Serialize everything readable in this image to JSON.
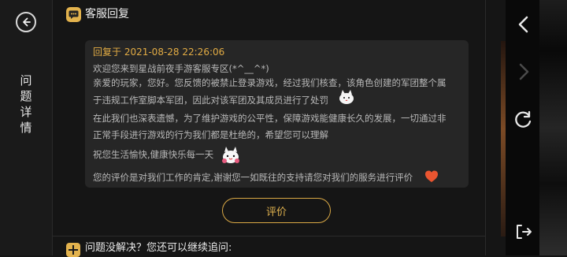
{
  "sidebar": {
    "title_chars": [
      "问",
      "题",
      "详",
      "情"
    ]
  },
  "section": {
    "title": "客服回复"
  },
  "reply": {
    "time": "回复于 2021-08-28 22:26:06",
    "lines": [
      "欢迎您来到星战前夜手游客服专区(*^__^*)",
      "亲爱的玩家，您好。您反馈的被禁止登录游戏，经过我们核查，该角色创建的军团整个属",
      "于违规工作室脚本军团，因此对该军团及其成员进行了处罚",
      "在此我们也深表遗憾，为了维护游戏的公平性，保障游戏能健康长久的发展，一切通过非",
      "正常手段进行游戏的行为我们都是杜绝的，希望您可以理解",
      "祝您生活愉快,健康快乐每一天",
      "您的评价是对我们工作的肯定,谢谢您一如既往的支持请您对我们的服务进行评价"
    ]
  },
  "actions": {
    "rate_label": "评价"
  },
  "followup": {
    "text": "问题没解决？您还可以继续追问:"
  },
  "icons": {
    "back": "back-icon",
    "chat": "chat-icon",
    "heart": "heart-icon",
    "prev": "chevron-left-icon",
    "next": "chevron-right-icon",
    "refresh": "refresh-icon",
    "exit": "exit-icon"
  },
  "colors": {
    "accent": "#e0b24f",
    "card": "#262626",
    "text": "#b8b8b8"
  }
}
